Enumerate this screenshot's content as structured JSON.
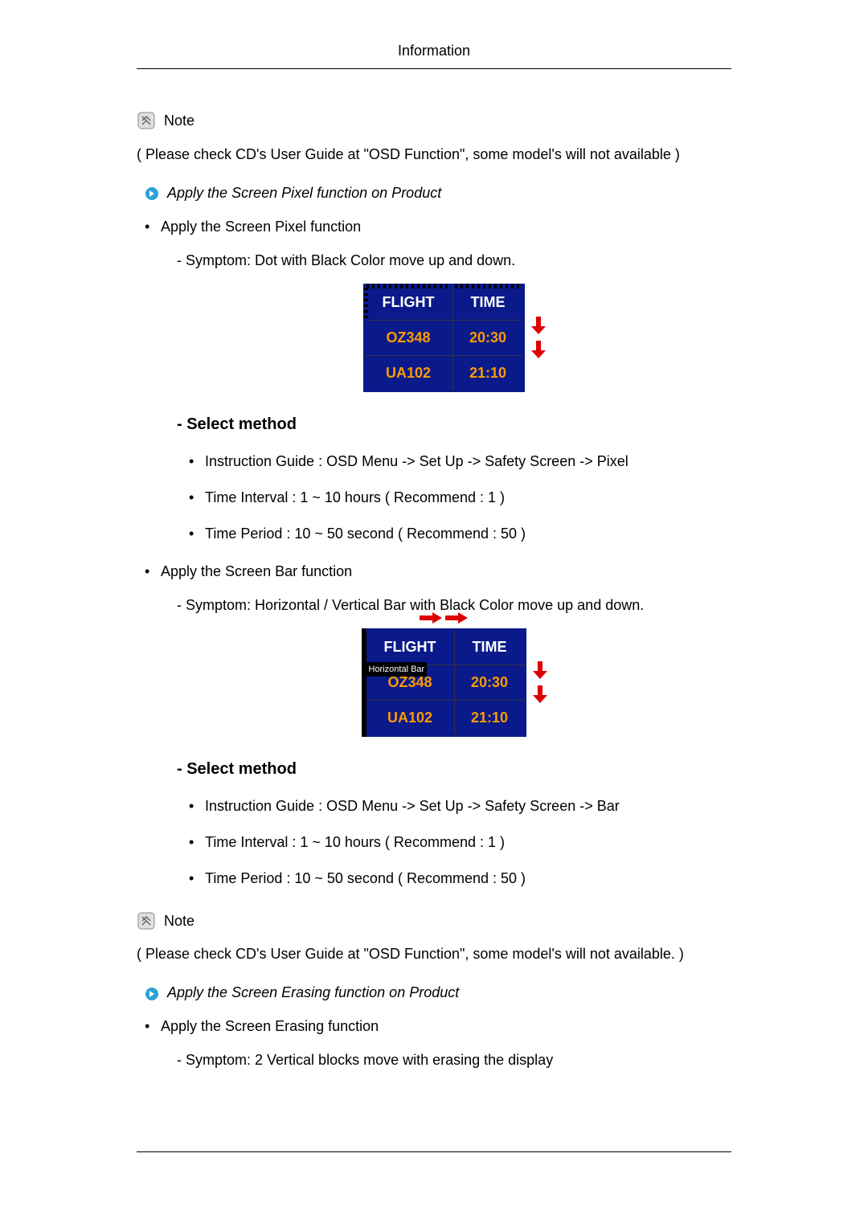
{
  "header": {
    "title": "Information"
  },
  "note1": {
    "label": "Note",
    "text": "( Please check CD's User Guide at \"OSD Function\", some model's will not available )"
  },
  "section_pixel": {
    "arrow_title": "Apply the Screen Pixel function on Product",
    "bullet_main": "Apply the Screen Pixel function",
    "symptom": "- Symptom: Dot with Black Color move up and down.",
    "select_method": "- Select method",
    "instructions": [
      "Instruction Guide : OSD Menu -> Set Up -> Safety Screen -> Pixel",
      "Time Interval : 1 ~ 10 hours ( Recommend : 1 )",
      "Time Period : 10 ~ 50 second ( Recommend : 50 )"
    ]
  },
  "section_bar": {
    "bullet_main": "Apply the Screen Bar function",
    "symptom": "- Symptom: Horizontal / Vertical Bar with Black Color move up and down.",
    "hbar_label": "Horizontal Bar",
    "select_method": "- Select method",
    "instructions": [
      "Instruction Guide : OSD Menu -> Set Up -> Safety Screen -> Bar",
      "Time Interval : 1 ~ 10 hours ( Recommend : 1 )",
      "Time Period : 10 ~ 50 second ( Recommend : 50 )"
    ]
  },
  "note2": {
    "label": "Note",
    "text": "( Please check CD's User Guide at \"OSD Function\", some model's will not available. )"
  },
  "section_erasing": {
    "arrow_title": "Apply the Screen Erasing function on Product",
    "bullet_main": "Apply the Screen Erasing function",
    "symptom": "- Symptom: 2 Vertical blocks move with erasing the display"
  },
  "table_data": {
    "headers": [
      "FLIGHT",
      "TIME"
    ],
    "rows": [
      {
        "flight": "OZ348",
        "time": "20:30"
      },
      {
        "flight": "UA102",
        "time": "21:10"
      }
    ]
  }
}
